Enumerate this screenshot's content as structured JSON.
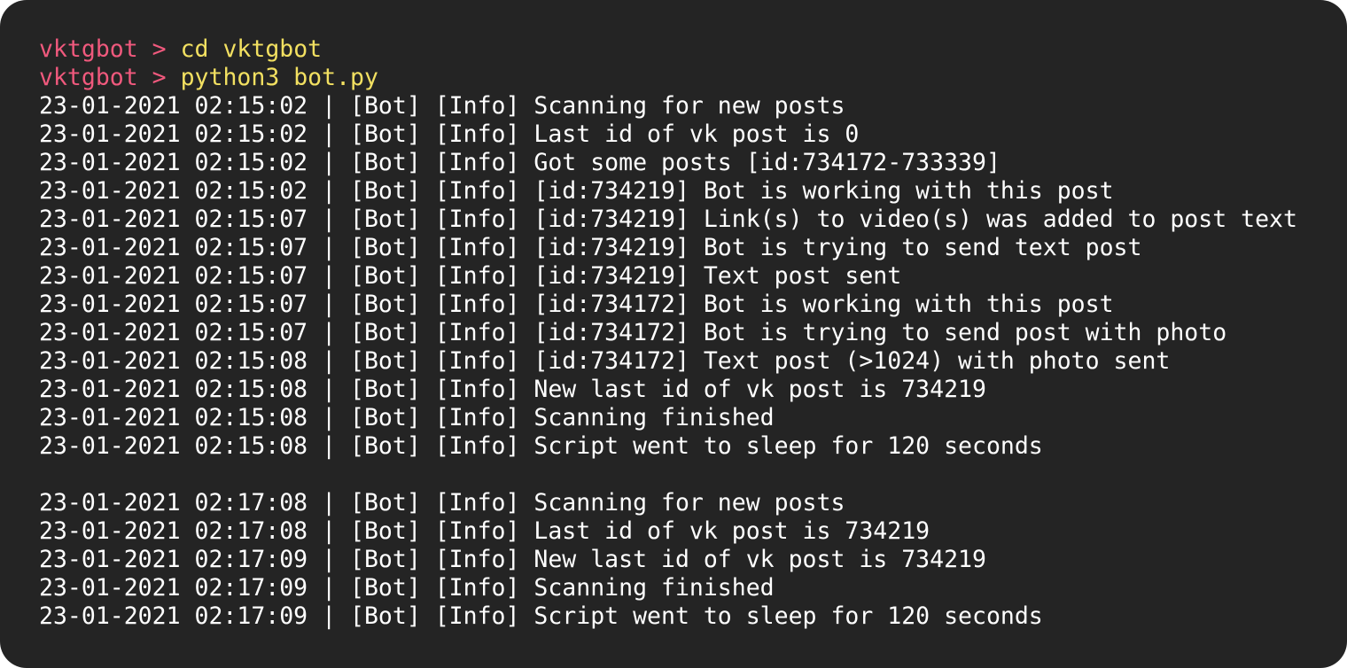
{
  "colors": {
    "background": "#242424",
    "prompt": "#f0597d",
    "command": "#f2e061",
    "output": "#ffffff"
  },
  "commands": [
    {
      "dir": "vktgbot",
      "sep": ">",
      "cmd": "cd vktgbot"
    },
    {
      "dir": "vktgbot",
      "sep": ">",
      "cmd": "python3 bot.py"
    }
  ],
  "log_block_1": [
    "23-01-2021 02:15:02 | [Bot] [Info] Scanning for new posts",
    "23-01-2021 02:15:02 | [Bot] [Info] Last id of vk post is 0",
    "23-01-2021 02:15:02 | [Bot] [Info] Got some posts [id:734172-733339]",
    "23-01-2021 02:15:02 | [Bot] [Info] [id:734219] Bot is working with this post",
    "23-01-2021 02:15:07 | [Bot] [Info] [id:734219] Link(s) to video(s) was added to post text",
    "23-01-2021 02:15:07 | [Bot] [Info] [id:734219] Bot is trying to send text post",
    "23-01-2021 02:15:07 | [Bot] [Info] [id:734219] Text post sent",
    "23-01-2021 02:15:07 | [Bot] [Info] [id:734172] Bot is working with this post",
    "23-01-2021 02:15:07 | [Bot] [Info] [id:734172] Bot is trying to send post with photo",
    "23-01-2021 02:15:08 | [Bot] [Info] [id:734172] Text post (>1024) with photo sent",
    "23-01-2021 02:15:08 | [Bot] [Info] New last id of vk post is 734219",
    "23-01-2021 02:15:08 | [Bot] [Info] Scanning finished",
    "23-01-2021 02:15:08 | [Bot] [Info] Script went to sleep for 120 seconds"
  ],
  "log_block_2": [
    "23-01-2021 02:17:08 | [Bot] [Info] Scanning for new posts",
    "23-01-2021 02:17:08 | [Bot] [Info] Last id of vk post is 734219",
    "23-01-2021 02:17:09 | [Bot] [Info] New last id of vk post is 734219",
    "23-01-2021 02:17:09 | [Bot] [Info] Scanning finished",
    "23-01-2021 02:17:09 | [Bot] [Info] Script went to sleep for 120 seconds"
  ]
}
